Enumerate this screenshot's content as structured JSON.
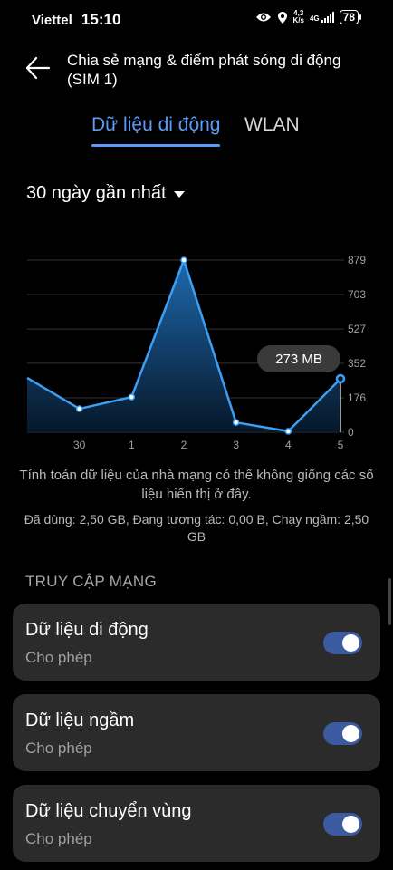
{
  "status_bar": {
    "carrier": "Viettel",
    "time": "15:10",
    "net_speed_value": "4,3",
    "net_speed_unit": "K/s",
    "network_type": "4G",
    "battery": "78",
    "icons": [
      "eye-icon",
      "location-icon",
      "signal-icon",
      "battery-icon"
    ]
  },
  "header": {
    "title": "Chia sẻ mạng & điểm phát sóng di động (SIM 1)",
    "back_icon": "arrow-left-icon"
  },
  "tabs": [
    {
      "label": "Dữ liệu di động",
      "active": true
    },
    {
      "label": "WLAN",
      "active": false
    }
  ],
  "period": {
    "label": "30 ngày gần nhất",
    "icon": "caret-down-icon"
  },
  "chart_data": {
    "type": "area",
    "categories": [
      "",
      "30",
      "1",
      "2",
      "3",
      "4",
      "5"
    ],
    "values": [
      278,
      120,
      180,
      879,
      50,
      5,
      273
    ],
    "yticks": [
      879,
      703,
      527,
      352,
      176,
      0
    ],
    "ylim": [
      0,
      879
    ],
    "tooltip": "273 MB",
    "colors": {
      "line": "#3d9ef2",
      "fill_top": "#1f6fb8",
      "fill_bottom": "#071a2e",
      "grid": "#333333"
    }
  },
  "info": {
    "note": "Tính toán dữ liệu của nhà mạng có thể không giống các số liệu hiển thị ở đây.",
    "usage": "Đã dùng: 2,50 GB, Đang tương tác: 0,00 B, Chạy ngầm: 2,50 GB"
  },
  "section": {
    "title": "TRUY CẬP MẠNG"
  },
  "toggles": [
    {
      "title": "Dữ liệu di động",
      "subtitle": "Cho phép",
      "on": true
    },
    {
      "title": "Dữ liệu ngầm",
      "subtitle": "Cho phép",
      "on": true
    },
    {
      "title": "Dữ liệu chuyển vùng",
      "subtitle": "Cho phép",
      "on": true
    }
  ]
}
